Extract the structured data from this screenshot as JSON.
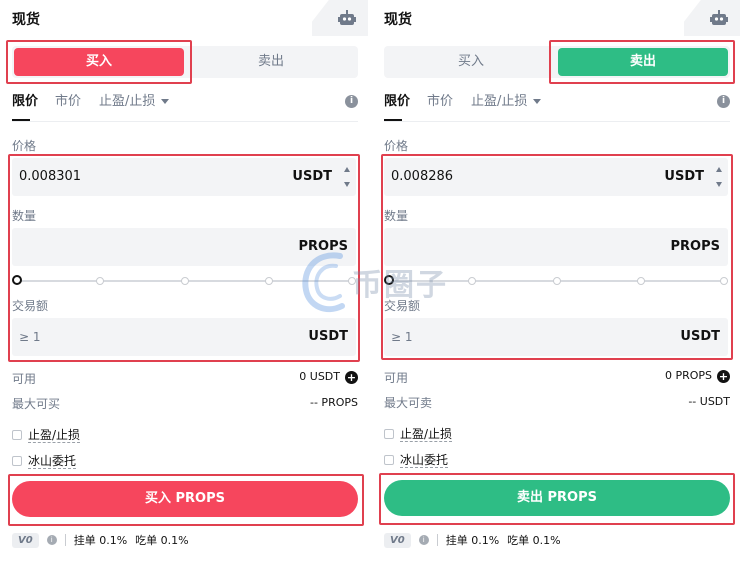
{
  "left": {
    "title": "现货",
    "tabs": {
      "buy": "买入",
      "sell": "卖出"
    },
    "order_types": [
      "限价",
      "市价",
      "止盈/止损"
    ],
    "price_label": "价格",
    "price_value": "0.008301",
    "price_unit": "USDT",
    "qty_label": "数量",
    "qty_unit": "PROPS",
    "amount_label": "交易额",
    "amount_placeholder": "≥ 1",
    "amount_unit": "USDT",
    "available_label": "可用",
    "available_value": "0 USDT",
    "max_label": "最大可买",
    "max_value": "-- PROPS",
    "tpsl_label": "止盈/止损",
    "iceberg_label": "冰山委托",
    "submit_label": "买入 PROPS",
    "vip_level": "V0",
    "maker_fee": "挂单 0.1%",
    "taker_fee": "吃单 0.1%"
  },
  "right": {
    "title": "现货",
    "tabs": {
      "buy": "买入",
      "sell": "卖出"
    },
    "order_types": [
      "限价",
      "市价",
      "止盈/止损"
    ],
    "price_label": "价格",
    "price_value": "0.008286",
    "price_unit": "USDT",
    "qty_label": "数量",
    "qty_unit": "PROPS",
    "amount_label": "交易额",
    "amount_placeholder": "≥ 1",
    "amount_unit": "USDT",
    "available_label": "可用",
    "available_value": "0 PROPS",
    "max_label": "最大可卖",
    "max_value": "-- USDT",
    "tpsl_label": "止盈/止损",
    "iceberg_label": "冰山委托",
    "submit_label": "卖出 PROPS",
    "vip_level": "V0",
    "maker_fee": "挂单 0.1%",
    "taker_fee": "吃单 0.1%"
  },
  "watermark": {
    "text": "币圈子"
  },
  "colors": {
    "buy": "#f6465d",
    "sell": "#2ebd85",
    "highlight": "#e0404f"
  },
  "icons": {
    "robot": "robot-icon",
    "info": "info-icon",
    "plus": "plus-icon"
  }
}
